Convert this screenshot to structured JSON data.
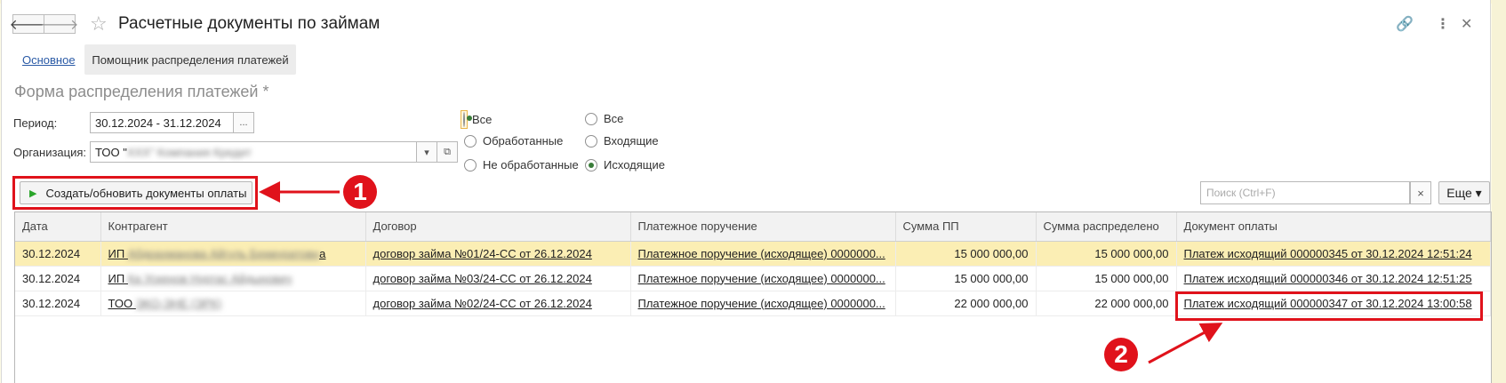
{
  "window": {
    "title": "Расчетные документы по займам",
    "back_icon": "arrow-left-icon",
    "forward_icon": "arrow-right-icon",
    "favorite_icon": "star-icon",
    "link_icon": "link-icon",
    "menu_icon": "kebab-icon",
    "close_icon": "close-icon"
  },
  "tabs": [
    {
      "label": "Основное"
    },
    {
      "label": "Помощник распределения платежей"
    }
  ],
  "form": {
    "title": "Форма распределения платежей *",
    "period_label": "Период:",
    "period_value": "30.12.2024 - 31.12.2024",
    "period_btn": "...",
    "org_label": "Организация:",
    "org_value_prefix": "ТОО \"",
    "org_value_blurred": "ХХХ\" Компания Кредит",
    "org_dropdown_icon": "▾",
    "org_open_icon": "⧉"
  },
  "filters": {
    "group1": [
      {
        "label": "Все",
        "checked": true
      },
      {
        "label": "Обработанные",
        "checked": false
      },
      {
        "label": "Не обработанные",
        "checked": false
      }
    ],
    "group2": [
      {
        "label": "Все",
        "checked": false
      },
      {
        "label": "Входящие",
        "checked": false
      },
      {
        "label": "Исходящие",
        "checked": true
      }
    ]
  },
  "toolbar": {
    "create_label": "Создать/обновить документы оплаты",
    "search_placeholder": "Поиск (Ctrl+F)",
    "search_clear": "×",
    "more_label": "Еще ▾"
  },
  "annotations": {
    "marker1": "1",
    "marker2": "2",
    "color": "#e0121b"
  },
  "table": {
    "columns": [
      "Дата",
      "Контрагент",
      "Договор",
      "Платежное поручение",
      "Сумма ПП",
      "Сумма распределено",
      "Документ оплаты"
    ],
    "rows": [
      {
        "date": "30.12.2024",
        "counterparty_prefix": "ИП ",
        "counterparty_blur": "Абдрахманова Айгуль Бекмуратовн",
        "counterparty_suffix": "а",
        "contract": "договор займа №01/24-СС от 26.12.2024",
        "payment_order": "Платежное поручение (исходящее) 0000000...",
        "sum_pp": "15 000 000,00",
        "sum_distributed": "15 000 000,00",
        "payment_doc": "Платеж исходящий 000000345 от 30.12.2024 12:51:24"
      },
      {
        "date": "30.12.2024",
        "counterparty_prefix": "ИП ",
        "counterparty_blur": "Ка Ускенов Нуртас Айдынович",
        "counterparty_suffix": "",
        "contract": "договор займа №03/24-СС от 26.12.2024",
        "payment_order": "Платежное поручение (исходящее) 0000000...",
        "sum_pp": "15 000 000,00",
        "sum_distributed": "15 000 000,00",
        "payment_doc": "Платеж исходящий 000000346 от 30.12.2024 12:51:25"
      },
      {
        "date": "30.12.2024",
        "counterparty_prefix": "ТОО ",
        "counterparty_blur": "ЭКО-ЭНЕ (ЭРК)",
        "counterparty_suffix": "",
        "contract": "договор займа №02/24-СС от 26.12.2024",
        "payment_order": "Платежное поручение (исходящее) 0000000...",
        "sum_pp": "22 000 000,00",
        "sum_distributed": "22 000 000,00",
        "payment_doc": "Платеж исходящий 000000347 от 30.12.2024 13:00:58"
      }
    ]
  }
}
